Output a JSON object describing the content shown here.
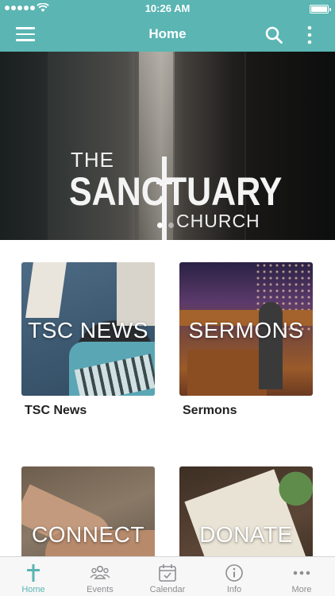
{
  "status_bar": {
    "time": "10:26 AM"
  },
  "nav": {
    "title": "Home"
  },
  "hero": {
    "logo": {
      "the": "THE",
      "main": "SANCTUARY",
      "church": "CHURCH"
    },
    "pages": 2,
    "active_page": 1
  },
  "cards": [
    {
      "overlay": "TSC NEWS",
      "label": "TSC News"
    },
    {
      "overlay": "SERMONS",
      "label": "Sermons"
    },
    {
      "overlay": "CONNECT",
      "label": ""
    },
    {
      "overlay": "DONATE",
      "label": ""
    }
  ],
  "tabs": [
    {
      "label": "Home",
      "icon": "cross-icon",
      "active": true
    },
    {
      "label": "Events",
      "icon": "people-icon",
      "active": false
    },
    {
      "label": "Calendar",
      "icon": "calendar-icon",
      "active": false
    },
    {
      "label": "Info",
      "icon": "info-icon",
      "active": false
    },
    {
      "label": "More",
      "icon": "ellipsis-icon",
      "active": false
    }
  ],
  "colors": {
    "brand": "#5ab5b3",
    "tab_inactive": "#8e8e93"
  }
}
